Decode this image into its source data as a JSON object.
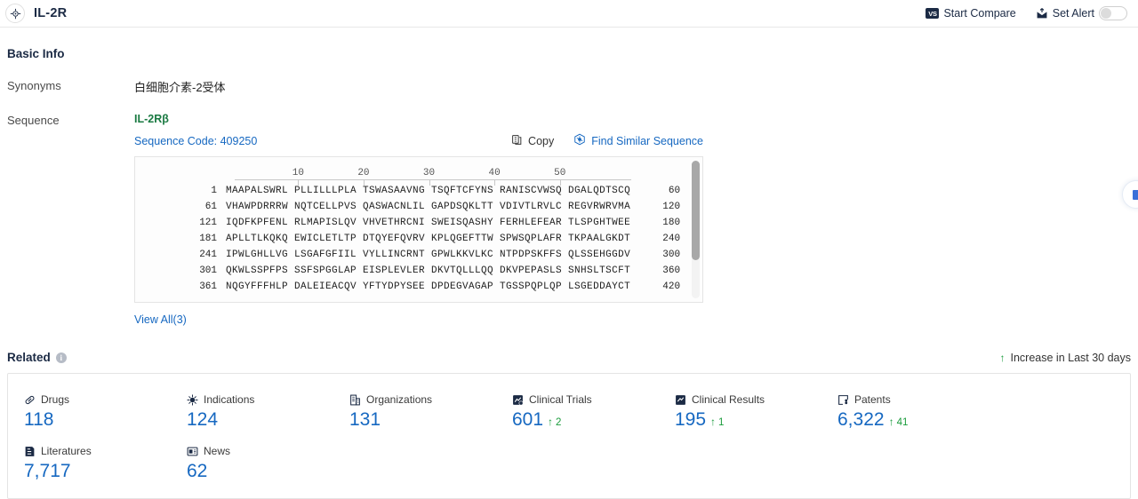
{
  "header": {
    "logo_icon": "target-crosshair-icon",
    "title": "IL-2R",
    "start_compare_label": "Start Compare",
    "start_compare_badge": "VS",
    "set_alert_label": "Set Alert",
    "alert_icon": "alert-bell-icon",
    "toggle_state": "off"
  },
  "basic_info": {
    "section_title": "Basic Info",
    "rows": [
      {
        "label": "Synonyms",
        "value": "白细胞介素-2受体"
      },
      {
        "label": "Sequence",
        "value": ""
      }
    ],
    "sequence": {
      "name": "IL-2Rβ",
      "code_label": "Sequence Code: 409250",
      "copy_label": "Copy",
      "copy_icon": "copy-icon",
      "find_similar_label": "Find Similar Sequence",
      "find_similar_icon": "find-similar-icon",
      "view_all_label": "View All(3)",
      "ruler_ticks": [
        10,
        20,
        30,
        40,
        50
      ],
      "lines": [
        {
          "start": "1",
          "chunks": "MAAPALSWRL PLLILLLPLA TSWASAAVNG TSQFTCFYNS RANISCVWSQ DGALQDTSCQ",
          "end": "60"
        },
        {
          "start": "61",
          "chunks": "VHAWPDRRRW NQTCELLPVS QASWACNLIL GAPDSQKLTT VDIVTLRVLC REGVRWRVMA",
          "end": "120"
        },
        {
          "start": "121",
          "chunks": "IQDFKPFENL RLMAPISLQV VHVETHRCNI SWEISQASHY FERHLEFEAR TLSPGHTWEE",
          "end": "180"
        },
        {
          "start": "181",
          "chunks": "APLLTLKQKQ EWICLETLTP DTQYEFQVRV KPLQGEFTTW SPWSQPLAFR TKPAALGKDT",
          "end": "240"
        },
        {
          "start": "241",
          "chunks": "IPWLGHLLVG LSGAFGFIIL VYLLINCRNT GPWLKKVLKC NTPDPSKFFS QLSSEHGGDV",
          "end": "300"
        },
        {
          "start": "301",
          "chunks": "QKWLSSPFPS SSFSPGGLAP EISPLEVLER DKVTQLLLQQ DKVPEPASLS SNHSLTSCFT",
          "end": "360"
        },
        {
          "start": "361",
          "chunks": "NQGYFFFHLP DALEIEACQV YFTYDPYSEE DPDEGVAGAP TGSSPQPLQP LSGEDDAYCT",
          "end": "420"
        }
      ]
    }
  },
  "related": {
    "title": "Related",
    "info_glyph": "i",
    "legend_label": "Increase in Last 30 days",
    "legend_arrow": "↑",
    "tiles": [
      {
        "label": "Drugs",
        "icon": "pill-icon",
        "value": "118",
        "delta": ""
      },
      {
        "label": "Indications",
        "icon": "virus-icon",
        "value": "124",
        "delta": ""
      },
      {
        "label": "Organizations",
        "icon": "building-icon",
        "value": "131",
        "delta": ""
      },
      {
        "label": "Clinical Trials",
        "icon": "clinical-trial-icon",
        "value": "601",
        "delta": "2"
      },
      {
        "label": "Clinical Results",
        "icon": "clinical-result-icon",
        "value": "195",
        "delta": "1"
      },
      {
        "label": "Patents",
        "icon": "patent-icon",
        "value": "6,322",
        "delta": "41"
      },
      {
        "label": "Literatures",
        "icon": "literature-icon",
        "value": "7,717",
        "delta": ""
      },
      {
        "label": "News",
        "icon": "news-icon",
        "value": "62",
        "delta": ""
      }
    ]
  },
  "colors": {
    "accent_blue": "#1668c1",
    "dark_navy": "#1b2a44",
    "green": "#1a9c3c",
    "seq_green": "#1a7a42"
  }
}
